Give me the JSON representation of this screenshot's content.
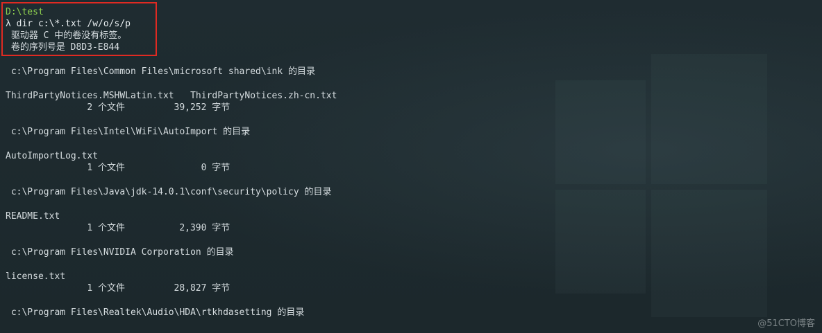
{
  "colors": {
    "background": "#1f2b30",
    "text": "#d6dde0",
    "prompt_path": "#8fd14f",
    "highlight_border": "#e02a22"
  },
  "terminal": {
    "prompt_path": "D:\\test",
    "command": "λ dir c:\\*.txt /w/o/s/p",
    "volume_label": " 驱动器 C 中的卷没有标签。",
    "volume_serial": " 卷的序列号是 D8D3-E844",
    "sections": [
      {
        "dir": " c:\\Program Files\\Common Files\\microsoft shared\\ink 的目录",
        "files": "ThirdPartyNotices.MSHWLatin.txt   ThirdPartyNotices.zh-cn.txt",
        "summary": "               2 个文件         39,252 字节"
      },
      {
        "dir": " c:\\Program Files\\Intel\\WiFi\\AutoImport 的目录",
        "files": "AutoImportLog.txt",
        "summary": "               1 个文件              0 字节"
      },
      {
        "dir": " c:\\Program Files\\Java\\jdk-14.0.1\\conf\\security\\policy 的目录",
        "files": "README.txt",
        "summary": "               1 个文件          2,390 字节"
      },
      {
        "dir": " c:\\Program Files\\NVIDIA Corporation 的目录",
        "files": "license.txt",
        "summary": "               1 个文件         28,827 字节"
      },
      {
        "dir": " c:\\Program Files\\Realtek\\Audio\\HDA\\rtkhdasetting 的目录"
      }
    ]
  },
  "watermark": "@51CTO博客"
}
